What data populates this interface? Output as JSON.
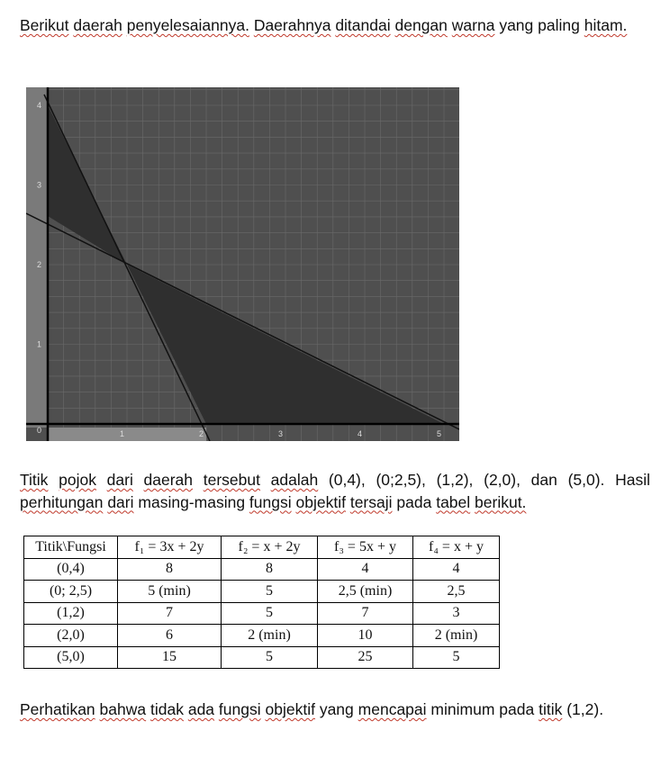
{
  "paragraph1": {
    "words": [
      "Berikut",
      "daerah",
      "penyelesaiannya.",
      "Daerahnya",
      "ditandai",
      "dengan",
      "warna",
      "yang",
      "paling",
      "hitam."
    ],
    "squiggly": [
      true,
      true,
      true,
      true,
      true,
      true,
      true,
      false,
      false,
      true
    ]
  },
  "graph": {
    "x_ticks": [
      "0",
      "1",
      "2",
      "3",
      "4",
      "5"
    ],
    "y_ticks": [
      "1",
      "2",
      "3",
      "4"
    ]
  },
  "paragraph2": {
    "words": [
      "Titik",
      "pojok",
      "dari",
      "daerah",
      "tersebut",
      "adalah",
      "(0,4),",
      "(0;2,5),",
      "(1,2),",
      "(2,0),",
      "dan",
      "(5,0).",
      "Hasil",
      "perhitungan",
      "dari",
      "masing-masing",
      "fungsi",
      "objektif",
      "tersaji",
      "pada",
      "tabel",
      "berikut."
    ],
    "squiggly": [
      true,
      true,
      true,
      true,
      true,
      true,
      false,
      false,
      false,
      false,
      false,
      false,
      false,
      true,
      true,
      false,
      true,
      true,
      true,
      false,
      true,
      true
    ]
  },
  "table": {
    "header": [
      "Titik\\Fungsi",
      "f₁ = 3x + 2y",
      "f₂ = x + 2y",
      "f₃ = 5x + y",
      "f₄ = x + y"
    ],
    "rows": [
      [
        "(0,4)",
        "8",
        "8",
        "4",
        "4"
      ],
      [
        "(0; 2,5)",
        "5 (min)",
        "5",
        "2,5 (min)",
        "2,5"
      ],
      [
        "(1,2)",
        "7",
        "5",
        "7",
        "3"
      ],
      [
        "(2,0)",
        "6",
        "2 (min)",
        "10",
        "2 (min)"
      ],
      [
        "(5,0)",
        "15",
        "5",
        "25",
        "5"
      ]
    ]
  },
  "paragraph3": {
    "words": [
      "Perhatikan",
      "bahwa",
      "tidak",
      "ada",
      "fungsi",
      "objektif",
      "yang",
      "mencapai",
      "minimum",
      "pada",
      "titik",
      "(1,2)."
    ],
    "squiggly": [
      true,
      true,
      true,
      true,
      true,
      true,
      false,
      true,
      false,
      false,
      true,
      false
    ]
  },
  "colors": {
    "plot_bg": "#4f4f4f",
    "region_dark": "#2f2f2f",
    "region_light": "#878787",
    "grid": "#6a6a6a",
    "squiggle": "#c0392b"
  }
}
